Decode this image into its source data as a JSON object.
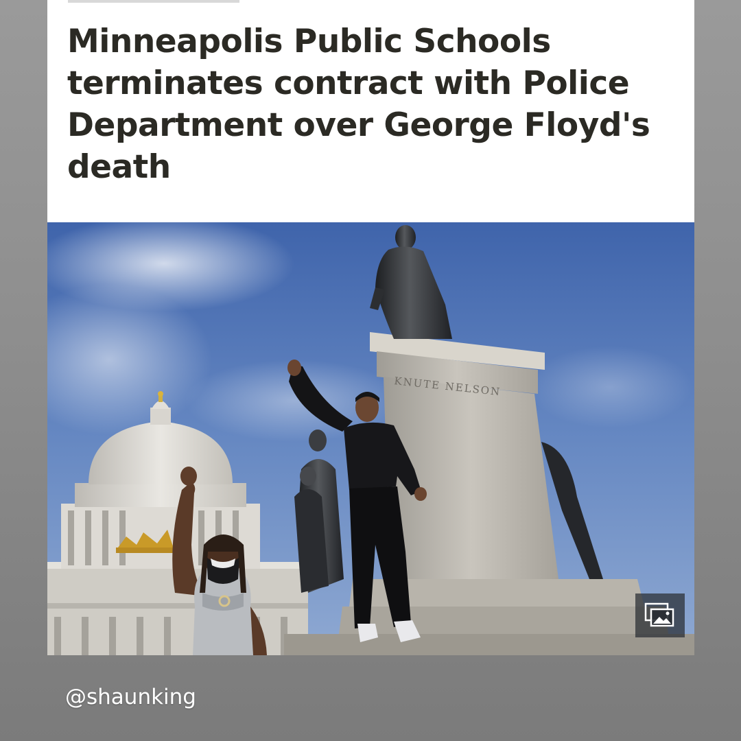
{
  "article": {
    "headline": "Minneapolis Public Schools terminates contract with Police Department over George Floyd's death"
  },
  "photo": {
    "pedestal_inscription": "KNUTE NELSON",
    "gallery_icon": "image-gallery-icon"
  },
  "footer": {
    "handle": "@shaunking"
  },
  "colors": {
    "headline_text": "#2b2a24",
    "card_background": "#ffffff",
    "page_background": "#8e8e8e",
    "sky": "#5a7cb8"
  }
}
